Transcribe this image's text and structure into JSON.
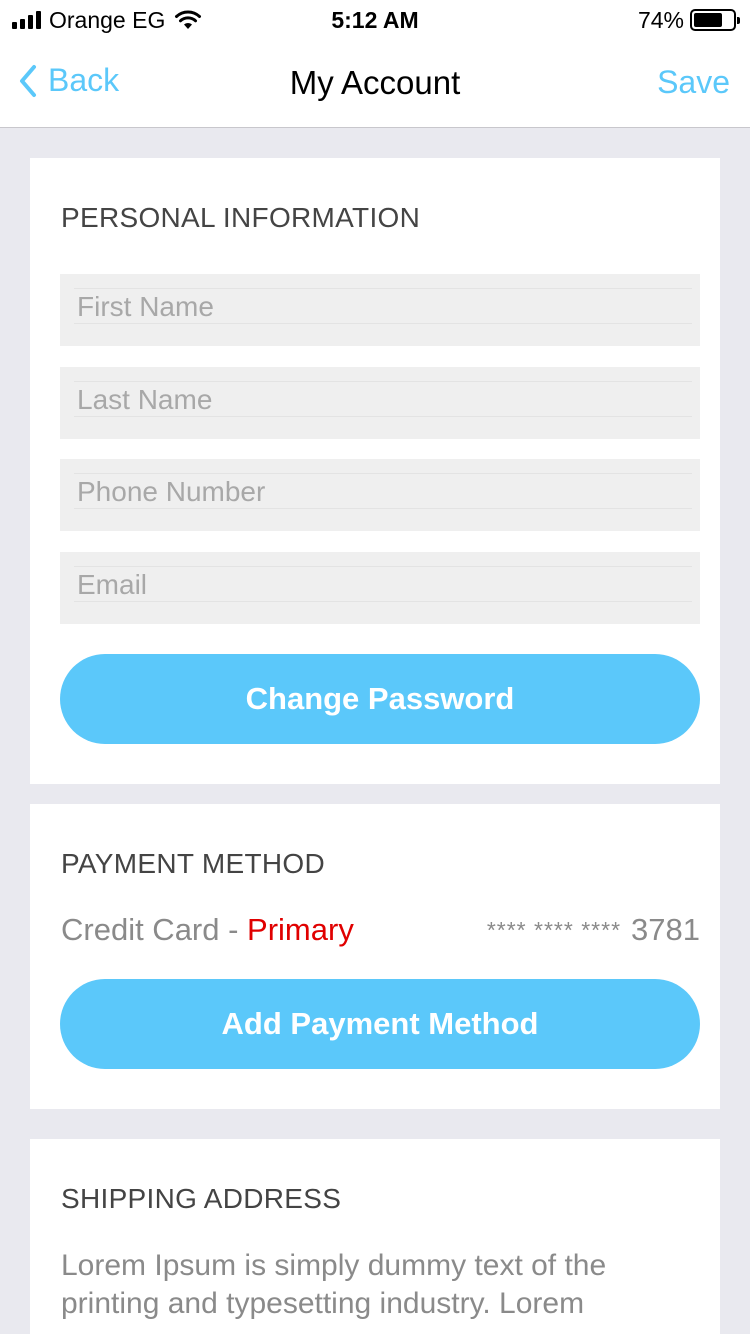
{
  "status_bar": {
    "carrier": "Orange EG",
    "time": "5:12 AM",
    "battery_percent": "74%",
    "battery_level": 0.74
  },
  "nav": {
    "back_label": "Back",
    "title": "My Account",
    "save_label": "Save",
    "accent_color": "#5bc8fa"
  },
  "personal": {
    "title": "PERSONAL INFORMATION",
    "first_name": {
      "value": "",
      "placeholder": "First Name"
    },
    "last_name": {
      "value": "",
      "placeholder": "Last Name"
    },
    "phone": {
      "value": "",
      "placeholder": "Phone Number"
    },
    "email": {
      "value": "",
      "placeholder": "Email"
    },
    "change_password_label": "Change Password"
  },
  "payment": {
    "title": "PAYMENT METHOD",
    "card_type": "Credit Card - ",
    "card_status": "Primary",
    "card_mask": "**** **** ****",
    "card_last4": "3781",
    "add_label": "Add Payment Method"
  },
  "shipping": {
    "title": "SHIPPING ADDRESS",
    "address_text": "Lorem Ipsum is simply dummy text of the printing and typesetting industry. Lorem"
  }
}
